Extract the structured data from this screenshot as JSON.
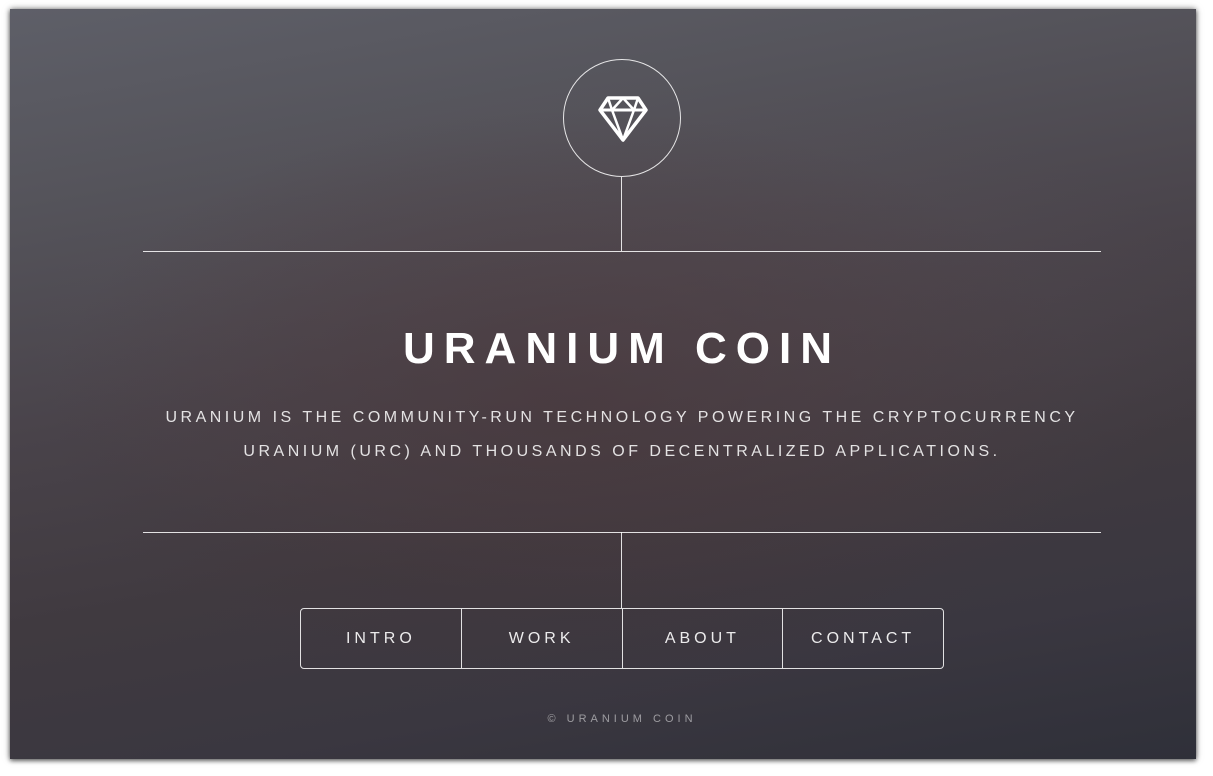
{
  "logo": {
    "icon": "diamond-icon"
  },
  "hero": {
    "title": "URANIUM COIN",
    "description_line1": "URANIUM IS THE COMMUNITY-RUN TECHNOLOGY POWERING THE CRYPTOCURRENCY",
    "description_line2": "URANIUM (URC) AND THOUSANDS OF DECENTRALIZED APPLICATIONS."
  },
  "nav": {
    "items": [
      {
        "label": "INTRO"
      },
      {
        "label": "WORK"
      },
      {
        "label": "ABOUT"
      },
      {
        "label": "CONTACT"
      }
    ]
  },
  "footer": {
    "copyright": "© URANIUM COIN"
  },
  "colors": {
    "line": "#ffffff",
    "background_top": "#5e5f68",
    "background_bottom": "#2f3039"
  }
}
